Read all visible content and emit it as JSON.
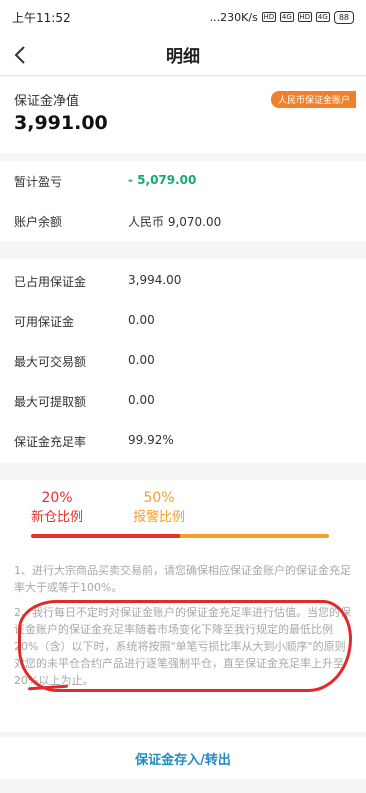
{
  "status_bar": {
    "time": "上午11:52",
    "speed": "...230K/s",
    "hd1": "HD",
    "sig1": "4G",
    "hd2": "HD",
    "sig2": "4G",
    "battery": "88"
  },
  "nav": {
    "title": "明细"
  },
  "summary": {
    "net_label": "保证金净值",
    "net_value": "3,991.00",
    "badge": "人民币保证金账户"
  },
  "rows_a": [
    {
      "key": "暂计盈亏",
      "value": "- 5,079.00"
    },
    {
      "key": "账户余额",
      "value": "人民币 9,070.00"
    }
  ],
  "rows_b": [
    {
      "key": "已占用保证金",
      "value": "3,994.00"
    },
    {
      "key": "可用保证金",
      "value": "0.00"
    },
    {
      "key": "最大可交易额",
      "value": "0.00"
    },
    {
      "key": "最大可提取额",
      "value": "0.00"
    },
    {
      "key": "保证金充足率",
      "value": "99.92%"
    }
  ],
  "ratios": {
    "new_open_value": "20%",
    "new_open_label": "新仓比例",
    "warning_value": "50%",
    "warning_label": "报警比例",
    "red_fill": 0.5,
    "orange_fill": 0.5,
    "colors": {
      "red": "#e5312b",
      "orange": "#f2a12c"
    }
  },
  "notes": [
    "1、进行大宗商品买卖交易前，请您确保相应保证金账户的保证金充足率大于或等于100%。",
    "2、我行每日不定时对保证金账户的保证金充足率进行估值。当您的保证金账户的保证金充足率随着市场变化下降至我行规定的最低比例20%（含）以下时，系统将按照\"单笔亏损比率从大到小顺序\"的原则对您的未平仓合约产品进行逐笔强制平仓，直至保证金充足率上升至20%以上为止。"
  ],
  "footer": {
    "action": "保证金存入/转出"
  }
}
